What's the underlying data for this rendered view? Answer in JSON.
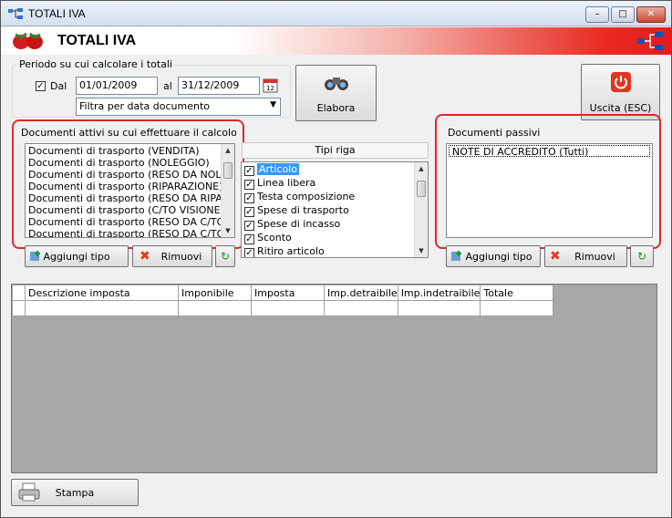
{
  "window": {
    "title": "TOTALI IVA",
    "minimize": "–",
    "maximize": "□",
    "close": "✕"
  },
  "header": {
    "title": "TOTALI IVA"
  },
  "period": {
    "group_label": "Periodo su cui calcolare i totali",
    "dal_label": "Dal",
    "dal_checked": true,
    "date_from": "01/01/2009",
    "al_label": "al",
    "date_to": "31/12/2009",
    "filter_selected": "Filtra per data documento"
  },
  "elabora_label": "Elabora",
  "uscita_label": "Uscita (ESC)",
  "active_docs": {
    "group_label": "Documenti attivi su cui effettuare il calcolo",
    "items": [
      "Documenti di trasporto (VENDITA)",
      "Documenti di trasporto (NOLEGGIO)",
      "Documenti di trasporto (RESO DA NOLEGGIO)",
      "Documenti di trasporto (RIPARAZIONE)",
      "Documenti di trasporto (RESO DA RIPARAZIONE)",
      "Documenti di trasporto (C/TO VISIONE)",
      "Documenti di trasporto (RESO DA C/TO VISIONE)",
      "Documenti di trasporto (RESO DA C/TO LAVORO)"
    ],
    "add_label": "Aggiungi tipo",
    "remove_label": "Rimuovi"
  },
  "tipi_riga": {
    "header": "Tipi riga",
    "items": [
      {
        "label": "Articolo",
        "checked": true,
        "selected": true
      },
      {
        "label": "Linea libera",
        "checked": true,
        "selected": false
      },
      {
        "label": "Testa composizione",
        "checked": true,
        "selected": false
      },
      {
        "label": "Spese di trasporto",
        "checked": true,
        "selected": false
      },
      {
        "label": "Spese di incasso",
        "checked": true,
        "selected": false
      },
      {
        "label": "Sconto",
        "checked": true,
        "selected": false
      },
      {
        "label": "Ritiro articolo",
        "checked": true,
        "selected": false
      }
    ]
  },
  "passive_docs": {
    "group_label": "Documenti passivi",
    "items": [
      "NOTE DI ACCREDITO (Tutti)"
    ],
    "add_label": "Aggiungi tipo",
    "remove_label": "Rimuovi"
  },
  "table": {
    "columns": [
      "Descrizione imposta",
      "Imponibile",
      "Imposta",
      "Imp.detraibile",
      "Imp.indetraibile",
      "Totale"
    ]
  },
  "stampa_label": "Stampa",
  "colors": {
    "accent_red": "#e02828",
    "header_red": "#e31b1b",
    "selection_blue": "#3399ff"
  }
}
